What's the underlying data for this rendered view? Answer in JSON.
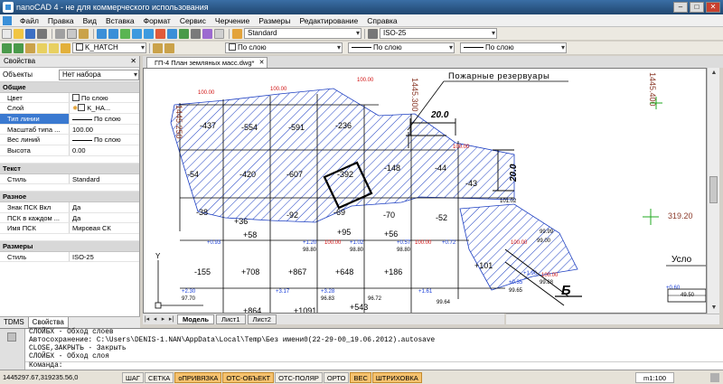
{
  "window": {
    "title": "nanoCAD 4 - не для коммерческого использования",
    "buttons": {
      "minimize": "–",
      "maximize": "□",
      "close": "✕"
    }
  },
  "menu": [
    "Файл",
    "Правка",
    "Вид",
    "Вставка",
    "Формат",
    "Сервис",
    "Черчение",
    "Размеры",
    "Редактирование",
    "Справка"
  ],
  "toolbar1": {
    "text_style": "Standard",
    "dim_style": "ISO-25"
  },
  "toolbar2": {
    "layer": "K_HATCH",
    "color": "По слою",
    "linetype": "По слою",
    "lineweight": "По слою"
  },
  "properties": {
    "title": "Свойства",
    "objects_label": "Объекты",
    "objects_value": "Нет набора",
    "categories": [
      {
        "name": "Общие",
        "rows": [
          {
            "label": "Цвет",
            "value": "По слою"
          },
          {
            "label": "Слой",
            "value": "K_HA..."
          },
          {
            "label": "Тип линии",
            "value": "По слою",
            "selected": true
          },
          {
            "label": "Масштаб типа ...",
            "value": "100.00"
          },
          {
            "label": "Вес линий",
            "value": "По слою"
          },
          {
            "label": "Высота",
            "value": "0.00"
          }
        ]
      },
      {
        "name": "Текст",
        "rows": [
          {
            "label": "Стиль",
            "value": "Standard"
          }
        ]
      },
      {
        "name": "Разное",
        "rows": [
          {
            "label": "Знак ПСК Вкл",
            "value": "Да"
          },
          {
            "label": "ПСК в каждом ...",
            "value": "Да"
          },
          {
            "label": "Имя ПСК",
            "value": "Мировая СК"
          }
        ]
      },
      {
        "name": "Размеры",
        "rows": [
          {
            "label": "Стиль",
            "value": "ISO-25"
          }
        ]
      }
    ]
  },
  "panel_tabs": [
    "TDMS",
    "Свойства"
  ],
  "document_tab": "ГП-4 План земляных масс.dwg*",
  "layout_tabs": [
    "Модель",
    "Лист1",
    "Лист2"
  ],
  "drawing": {
    "coord_left": "1445.250",
    "coord_mid": "1445.300",
    "coord_right": "1445.400",
    "callout": "Пожарные резервуары",
    "dim_top": "20.0",
    "dim_side": "20.0",
    "label_right": "319.20",
    "usl": "Усло",
    "b_label": "Б",
    "volumes_row1": [
      "-437",
      "-554",
      "-591",
      "-236"
    ],
    "volumes_row2": [
      "-54",
      "-420",
      "-607",
      "-392",
      "-148",
      "-44",
      "-43"
    ],
    "volumes_row3": [
      "-38",
      "+36",
      "-92",
      "-69",
      "-70",
      "-52"
    ],
    "volumes_row4": [
      "+58",
      "+95",
      "+56"
    ],
    "volumes_row5": [
      "-155",
      "+708",
      "+867",
      "+648",
      "+186",
      "+101"
    ],
    "volumes_row6": [
      "+864",
      "+1091",
      "+543"
    ],
    "small_red": [
      "100.00",
      "100.00",
      "100.00",
      "100.00",
      "100.00",
      "100.00",
      "100.00",
      "100.00"
    ],
    "small_blue": [
      "+0.93",
      "+1.20",
      "+1.02",
      "+0.57",
      "+0.72",
      "+1.96",
      "+0.35",
      "+2.30",
      "+3.17",
      "+3.28",
      "+1.61",
      "+0.60"
    ],
    "small_black": [
      "101.02",
      "99.99",
      "99.00",
      "98.80",
      "98.80",
      "98.80",
      "97.70",
      "96.83",
      "96.72",
      "99.64",
      "99.65",
      "99.88",
      "49.50"
    ]
  },
  "command_lines": [
    "СЛОЙБХ - Обход слоев",
    "Автосохранение: C:\\Users\\DENIS-1.NAN\\AppData\\Local\\Temp\\Без имени0(22-29-00_19.06.2012).autosave",
    "CLOSE,ЗАКРЫТЬ - Закрыть",
    "СЛОЙБХ - Обход слоя"
  ],
  "command_prompt": "Команда:",
  "status": {
    "coords": "1445297.67,319235.56,0",
    "toggles": [
      {
        "label": "ШАГ",
        "on": false
      },
      {
        "label": "СЕТКА",
        "on": false
      },
      {
        "label": "оПРИВЯЗКА",
        "on": true
      },
      {
        "label": "ОТС-ОБЪЕКТ",
        "on": true
      },
      {
        "label": "ОТС-ПОЛЯР",
        "on": false
      },
      {
        "label": "ОРТО",
        "on": false
      },
      {
        "label": "ВЕС",
        "on": true
      },
      {
        "label": "ШТРИХОВКА",
        "on": true
      }
    ],
    "scale": "m1:100"
  },
  "colors": {
    "hatch": "#1d3fc2",
    "red_text": "#d01010",
    "blue_text": "#1a3fd8",
    "status_on": "#f6c26e",
    "crosshair": "#22aa22"
  }
}
